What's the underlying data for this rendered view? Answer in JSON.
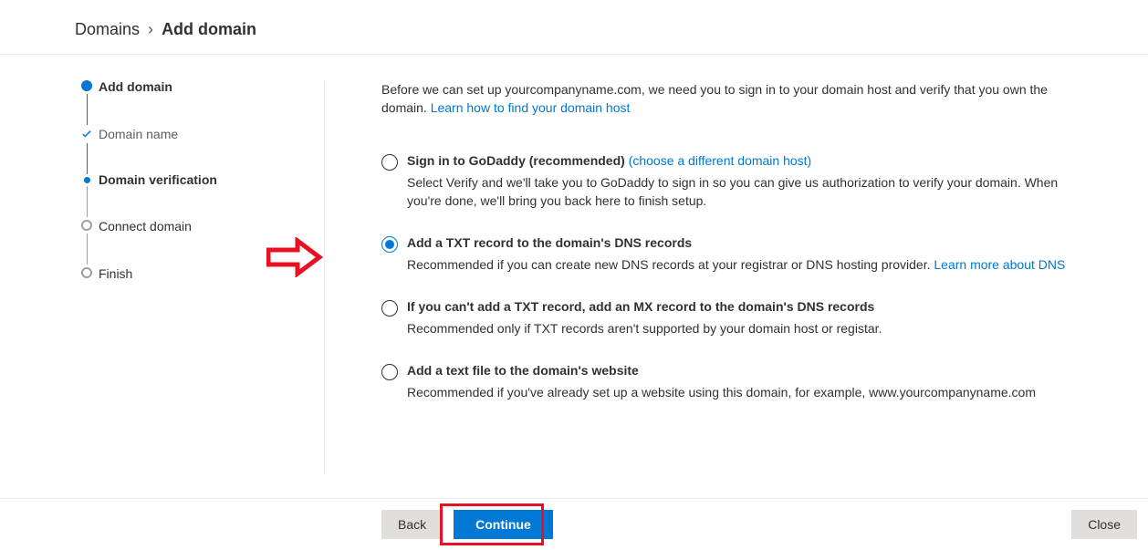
{
  "breadcrumb": {
    "root": "Domains",
    "sep": "›",
    "current": "Add domain"
  },
  "steps": {
    "add_domain": "Add domain",
    "domain_name": "Domain name",
    "domain_verification": "Domain verification",
    "connect_domain": "Connect domain",
    "finish": "Finish"
  },
  "intro": {
    "text": "Before we can set up yourcompanyname.com, we need you to sign in to your domain host and verify that you own the domain.",
    "link": "Learn how to find your domain host"
  },
  "options": {
    "godaddy": {
      "title": "Sign in to GoDaddy (recommended)",
      "inline_link": "(choose a different domain host)",
      "desc": "Select Verify and we'll take you to GoDaddy to sign in so you can give us authorization to verify your domain. When you're done, we'll bring you back here to finish setup."
    },
    "txt": {
      "title": "Add a TXT record to the domain's DNS records",
      "desc": "Recommended if you can create new DNS records at your registrar or DNS hosting provider.",
      "link": "Learn more about DNS"
    },
    "mx": {
      "title": "If you can't add a TXT record, add an MX record to the domain's DNS records",
      "desc": "Recommended only if TXT records aren't supported by your domain host or registar."
    },
    "file": {
      "title": "Add a text file to the domain's website",
      "desc": "Recommended if you've already set up a website using this domain, for example, www.yourcompanyname.com"
    }
  },
  "footer": {
    "back": "Back",
    "continue": "Continue",
    "close": "Close"
  }
}
